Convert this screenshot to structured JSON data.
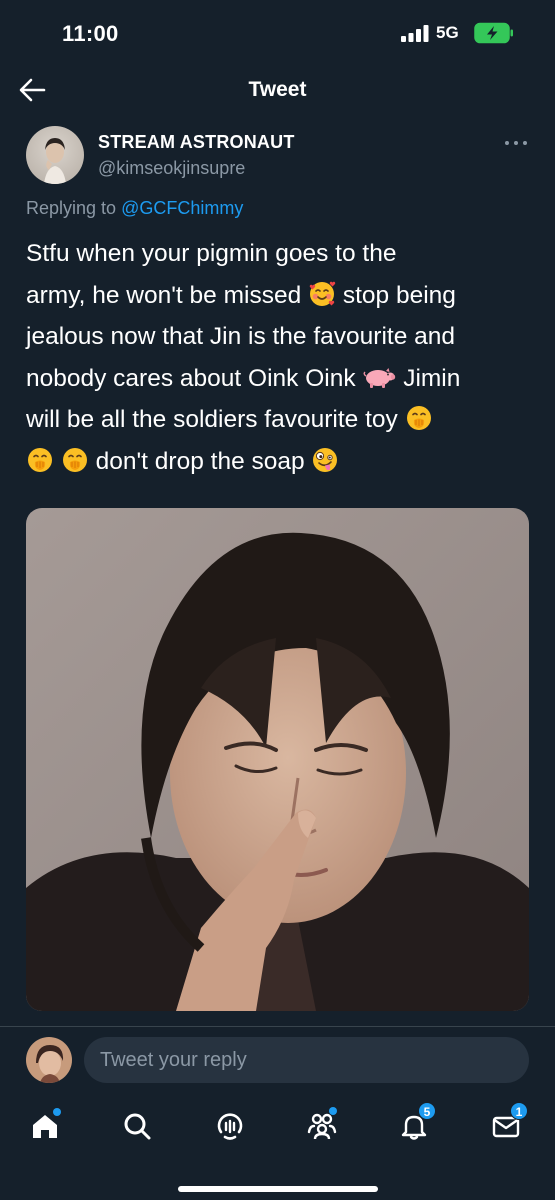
{
  "status_bar": {
    "time": "11:00",
    "network": "5G",
    "icons": [
      "signal-bars-icon",
      "battery-charging-icon"
    ]
  },
  "header": {
    "title": "Tweet",
    "back_icon": "arrow-left-icon"
  },
  "tweet": {
    "display_name": "STREAM ASTRONAUT",
    "handle": "@kimseokjinsupre",
    "replying_prefix": "Replying to",
    "replying_to": "@GCFChimmy",
    "text_lines": [
      "Stfu when your pigmin goes to the",
      "army, he won't be missed",
      "stop being",
      "jealous now that Jin is the favourite and",
      "nobody cares about Oink Oink",
      "Jimin",
      "will be all the soldiers favourite toy",
      "don't drop the soap"
    ],
    "emojis": [
      "smiling-face-with-hearts",
      "pig",
      "face-with-hand-over-mouth",
      "zany-face"
    ],
    "has_media": true
  },
  "reply": {
    "placeholder": "Tweet your reply"
  },
  "tab_bar": {
    "tabs": [
      {
        "name": "home",
        "icon": "home-icon",
        "indicator_dot": true
      },
      {
        "name": "search",
        "icon": "search-icon"
      },
      {
        "name": "spaces",
        "icon": "spaces-icon"
      },
      {
        "name": "communities",
        "icon": "communities-icon",
        "indicator_dot": true
      },
      {
        "name": "notifications",
        "icon": "bell-icon",
        "badge": "5"
      },
      {
        "name": "messages",
        "icon": "envelope-icon",
        "badge": "1"
      }
    ]
  },
  "colors": {
    "background": "#15202b",
    "accent": "#1d9bf0",
    "secondary_text": "#8b98a5",
    "divider": "#38444d",
    "input_background": "#273340",
    "battery_green": "#34c759"
  }
}
